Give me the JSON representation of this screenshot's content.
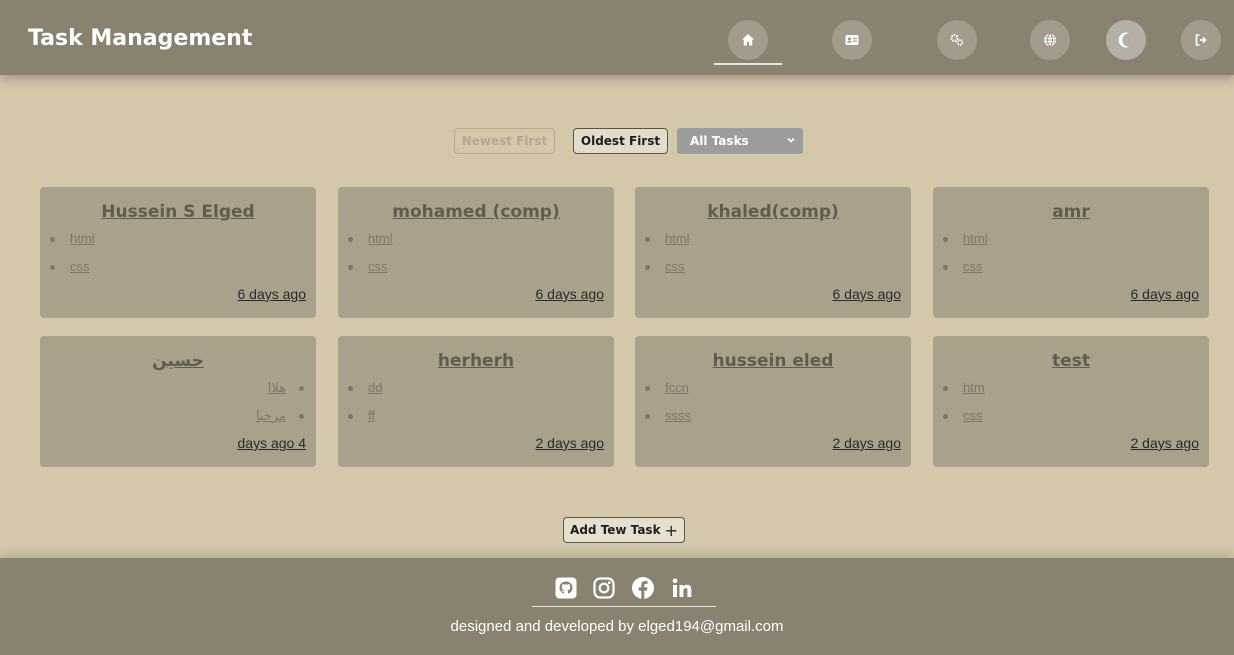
{
  "header": {
    "title": "Task Management",
    "nav": [
      {
        "name": "home-icon"
      },
      {
        "name": "id-card-icon"
      },
      {
        "name": "gears-icon"
      },
      {
        "name": "globe-icon"
      },
      {
        "name": "moon-icon"
      },
      {
        "name": "logout-icon"
      }
    ]
  },
  "controls": {
    "newest_label": "Newest First",
    "oldest_label": "Oldest First",
    "filter_selected": "All Tasks"
  },
  "cards": [
    {
      "title": "Hussein S Elged",
      "items": [
        "html",
        "css"
      ],
      "time": "6 days ago",
      "rtl": false
    },
    {
      "title": "mohamed (comp)",
      "items": [
        "html",
        "css"
      ],
      "time": "6 days ago",
      "rtl": false
    },
    {
      "title": "khaled(comp)",
      "items": [
        "html",
        "css"
      ],
      "time": "6 days ago",
      "rtl": false
    },
    {
      "title": "amr",
      "items": [
        "html",
        "css"
      ],
      "time": "6 days ago",
      "rtl": false
    },
    {
      "title": "حسين",
      "items": [
        "هلاا",
        "مرحبا"
      ],
      "time": "days ago 4",
      "rtl": true
    },
    {
      "title": "herherh",
      "items": [
        "dd",
        "ff"
      ],
      "time": "2 days ago",
      "rtl": false
    },
    {
      "title": "hussein eled",
      "items": [
        "fccn",
        "ssss"
      ],
      "time": "2 days ago",
      "rtl": false
    },
    {
      "title": "test",
      "items": [
        "htm",
        "css"
      ],
      "time": "2 days ago",
      "rtl": false
    }
  ],
  "add_task": {
    "label": "Add Tew Task",
    "icon": "+"
  },
  "footer": {
    "social": [
      "github-icon",
      "instagram-icon",
      "facebook-icon",
      "linkedin-icon"
    ],
    "credit": "designed and developed by elged194@gmail.com"
  },
  "colors": {
    "header_bg": "#8a8270",
    "page_bg": "#d4c8ab",
    "card_bg": "#aaa18d",
    "nav_circle": "#a39c8c"
  }
}
